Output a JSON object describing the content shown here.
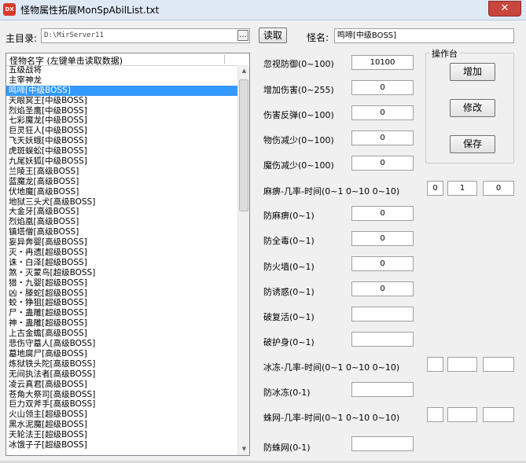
{
  "window": {
    "title": "怪物属性拓展MonSpAbilList.txt",
    "app_icon": "DX",
    "close_label": "✕"
  },
  "top": {
    "main_dir_label": "主目录:",
    "main_dir_value": "D:\\MirServer11",
    "browse_label": "...",
    "read_button": "读取",
    "monster_name_label": "怪名:",
    "monster_name_value": "鸣啼[中级BOSS]"
  },
  "list": {
    "header": "怪物名字 (左键单击读取数据)",
    "selected_index": 2,
    "items": [
      "五级战将",
      "主宰神龙",
      "鸣啼[中级BOSS]",
      "天眼冥王[中级BOSS]",
      "烈焰圣鹰[中级BOSS]",
      "七彩魔龙[中级BOSS]",
      "巨灵狂人[中级BOSS]",
      "飞天妖蛾[中级BOSS]",
      "虎斑蜈蚣[中级BOSS]",
      "九尾妖狐[中级BOSS]",
      "兰陵王[高级BOSS]",
      "蓝魔龙[高级BOSS]",
      "伏地魔[高级BOSS]",
      "地狱三头犬[高级BOSS]",
      "大金牙[高级BOSS]",
      "烈焰凰[高级BOSS]",
      "镇塔僧[高级BOSS]",
      "妄异奔婴[高级BOSS]",
      "灭・冉遗[超级BOSS]",
      "诛・白泽[超级BOSS]",
      "煞・灭蒙鸟[超级BOSS]",
      "猎・九婴[超级BOSS]",
      "凶・滕蛇[超级BOSS]",
      "蛟・狰狙[超级BOSS]",
      "尸・蛊雕[超级BOSS]",
      "神・蛊雕[超级BOSS]",
      "上古金蟾[高级BOSS]",
      "悲伤守墓人[高级BOSS]",
      "墓地腐尸[高级BOSS]",
      "炼狱铁头陀[高级BOSS]",
      "无间执法者[高级BOSS]",
      "凌云真君[高级BOSS]",
      "苍角大祭司[高级BOSS]",
      "巨力双斧手[高级BOSS]",
      "火山领主[超级BOSS]",
      "黑水泥魔[超级BOSS]",
      "天轮法王[超级BOSS]",
      "冰饿子子[超级BOSS]"
    ]
  },
  "fields": {
    "ignore_def": {
      "label": "忽视防御(0~100)",
      "value": "10100"
    },
    "add_dmg": {
      "label": "增加伤害(0~255)",
      "value": "0"
    },
    "reflect": {
      "label": "伤害反弹(0~100)",
      "value": "0"
    },
    "phys_reduce": {
      "label": "物伤减少(0~100)",
      "value": "0"
    },
    "magic_reduce": {
      "label": "魔伤减少(0~100)",
      "value": "0"
    },
    "paralyze": {
      "label": "麻痹-几率-时间(0~1 0~10 0~10)",
      "v1": "0",
      "v2": "1",
      "v3": "0"
    },
    "anti_paralyze": {
      "label": "防麻痹(0~1)",
      "value": "0"
    },
    "anti_poison": {
      "label": "防全毒(0~1)",
      "value": "0"
    },
    "anti_firewall": {
      "label": "防火墙(0~1)",
      "value": "0"
    },
    "anti_charm": {
      "label": "防诱惑(0~1)",
      "value": "0"
    },
    "break_revive": {
      "label": "破复活(0~1)",
      "value": ""
    },
    "break_shield": {
      "label": "破护身(0~1)",
      "value": ""
    },
    "freeze": {
      "label": "冰冻-几率-时间(0~1 0~10 0~10)",
      "v1": "",
      "v2": "",
      "v3": ""
    },
    "anti_freeze": {
      "label": "防冰冻(0-1)",
      "value": ""
    },
    "web": {
      "label": "蛛网-几率-时间(0~1 0~10 0~10)",
      "v1": "",
      "v2": "",
      "v3": ""
    },
    "anti_web": {
      "label": "防蛛网(0-1)",
      "value": ""
    }
  },
  "ops": {
    "title": "操作台",
    "add": "增加",
    "modify": "修改",
    "save": "保存"
  }
}
